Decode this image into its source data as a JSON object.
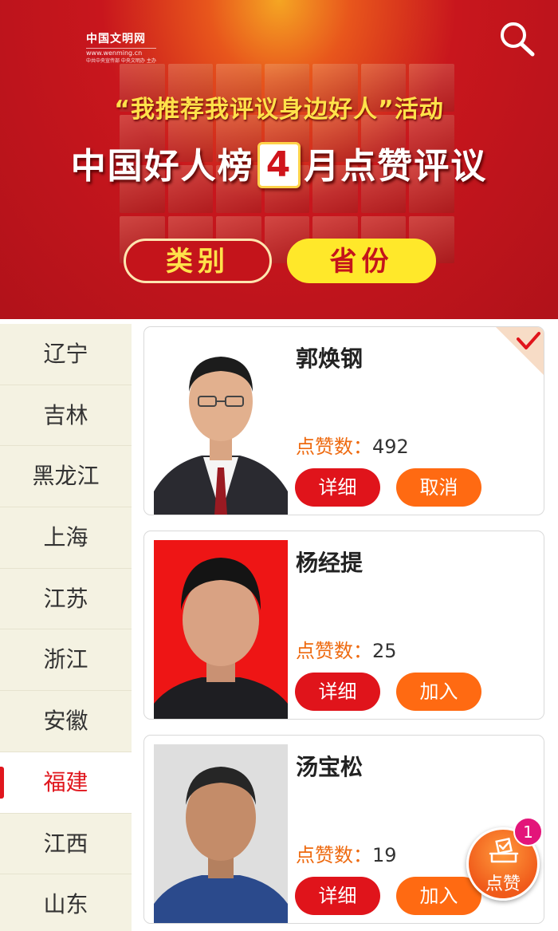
{
  "banner": {
    "logo_title": "中国文明网",
    "logo_url": "www.wenming.cn",
    "logo_sub": "中共中央宣传部 中央文明办 主办",
    "slogan": "“我推荐我评议身边好人”活动",
    "headline_prefix": "中国好人榜",
    "headline_month": "4",
    "headline_suffix": "月点赞评议",
    "search_icon": "search-icon"
  },
  "tabs": [
    {
      "label": "类别",
      "active": false
    },
    {
      "label": "省份",
      "active": true
    }
  ],
  "sidebar": {
    "items": [
      {
        "label": "辽宁"
      },
      {
        "label": "吉林"
      },
      {
        "label": "黑龙江"
      },
      {
        "label": "上海"
      },
      {
        "label": "江苏"
      },
      {
        "label": "浙江"
      },
      {
        "label": "安徽"
      },
      {
        "label": "福建"
      },
      {
        "label": "江西"
      },
      {
        "label": "山东"
      }
    ],
    "active_index": 7,
    "active_color": "#e0161d"
  },
  "cards": [
    {
      "name": "郭焕钢",
      "likes_label": "点赞数：",
      "likes": "492",
      "detail_label": "详细",
      "action_label": "取消",
      "selected": true,
      "photo_bg": "white"
    },
    {
      "name": "杨经提",
      "likes_label": "点赞数：",
      "likes": "25",
      "detail_label": "详细",
      "action_label": "加入",
      "selected": false,
      "photo_bg": "red"
    },
    {
      "name": "汤宝松",
      "likes_label": "点赞数：",
      "likes": "19",
      "detail_label": "详细",
      "action_label": "加入",
      "selected": false,
      "photo_bg": "grey"
    }
  ],
  "fab": {
    "label": "点赞",
    "badge": "1",
    "icon": "vote-box-icon"
  },
  "colors": {
    "brand_red": "#e0141b",
    "accent_orange": "#ff6a12",
    "tab_yellow": "#ffe82a",
    "badge_pink": "#e3157a"
  }
}
